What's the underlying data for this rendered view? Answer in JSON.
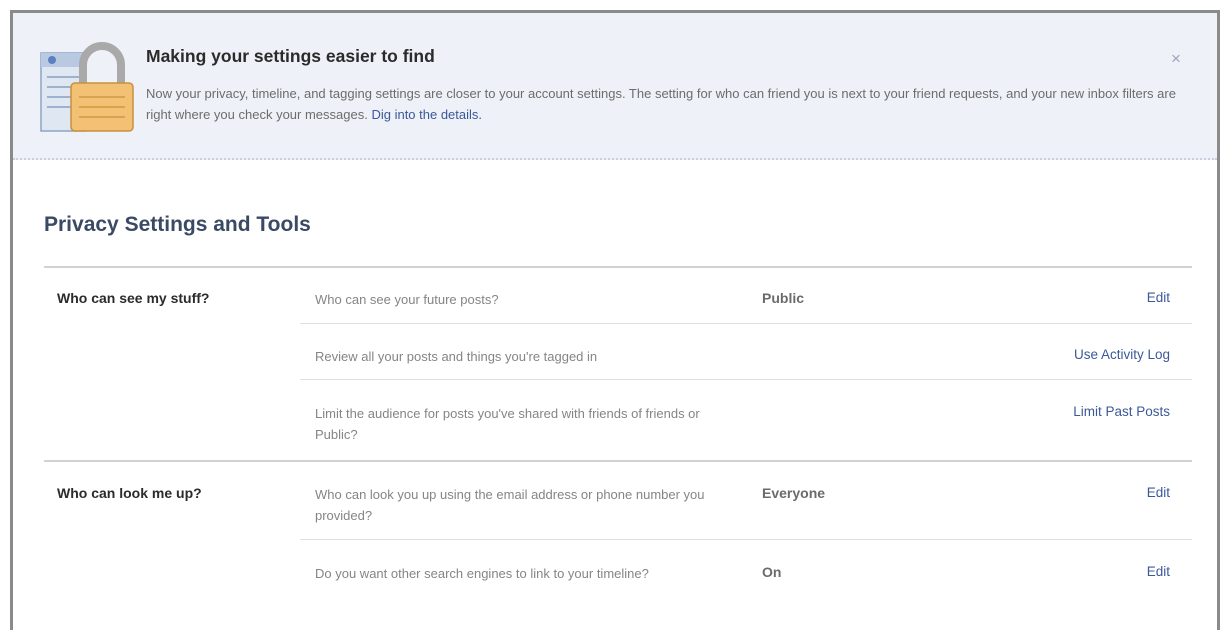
{
  "notice": {
    "icon": "lock-settings-icon",
    "title": "Making your settings easier to find",
    "body": "Now your privacy, timeline, and tagging settings are closer to your account settings. The setting for who can friend you is next to your friend requests, and your new inbox filters are right where you check your messages.",
    "link": "Dig into the details.",
    "close": "×"
  },
  "page": {
    "title": "Privacy Settings and Tools"
  },
  "groups": [
    {
      "label": "Who can see my stuff?",
      "rows": [
        {
          "question": "Who can see your future posts?",
          "value": "Public",
          "action": "Edit"
        },
        {
          "question": "Review all your posts and things you're tagged in",
          "value": "",
          "action": "Use Activity Log"
        },
        {
          "question": "Limit the audience for posts you've shared with friends of friends or Public?",
          "value": "",
          "action": "Limit Past Posts"
        }
      ]
    },
    {
      "label": "Who can look me up?",
      "rows": [
        {
          "question": "Who can look you up using the email address or phone number you provided?",
          "value": "Everyone",
          "action": "Edit"
        },
        {
          "question": "Do you want other search engines to link to your timeline?",
          "value": "On",
          "action": "Edit"
        }
      ]
    }
  ],
  "colors": {
    "link": "#3b5998",
    "title": "#3a4a64",
    "notice_bg": "#eef1f7"
  }
}
